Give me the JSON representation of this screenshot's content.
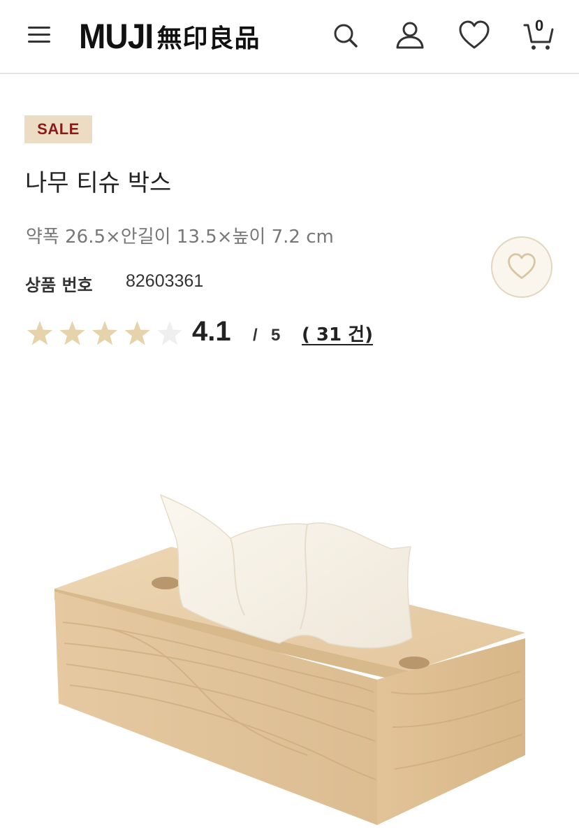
{
  "header": {
    "logo_latin": "MUJI",
    "logo_cjk": "無印良品",
    "cart_count": "0",
    "icons": [
      "menu-icon",
      "search-icon",
      "user-icon",
      "heart-icon",
      "cart-icon"
    ]
  },
  "product": {
    "badge": "SALE",
    "title": "나무 티슈 박스",
    "dimensions": "약폭 26.5×안길이 13.5×높이 7.2 cm",
    "product_no_label": "상품 번호",
    "product_no_value": "82603361"
  },
  "rating": {
    "value": "4.1",
    "separator": "/",
    "max": "5",
    "review_count_text": "( 31 건)",
    "stars_filled": 4,
    "stars_total": 5
  },
  "colors": {
    "badge_bg": "#ecdcc3",
    "badge_text": "#8b1a1a",
    "star_filled": "#e6d3ab",
    "star_empty": "#efefef",
    "wish_border": "#e3d6bf"
  }
}
